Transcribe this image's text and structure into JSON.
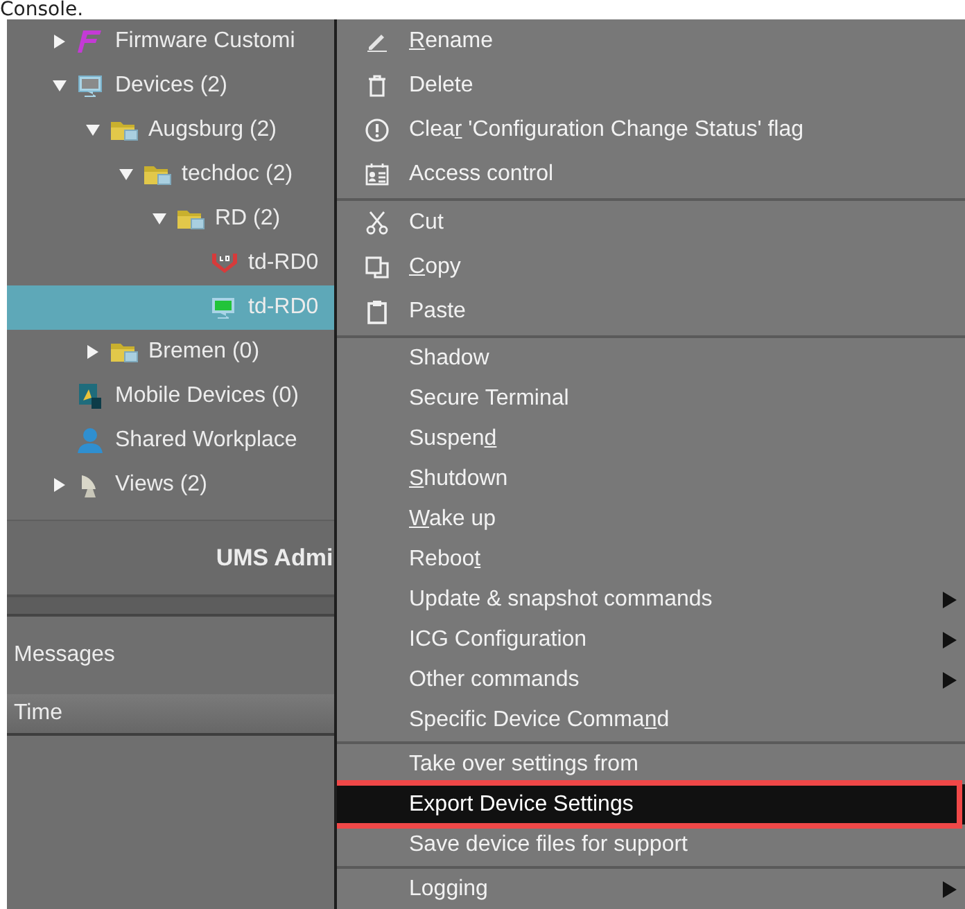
{
  "caption": "Console.",
  "tree": {
    "items": [
      {
        "label": "Firmware Customi",
        "kind": "firmware",
        "expanded": false,
        "selected": false
      },
      {
        "label": "Devices (2)",
        "kind": "devices",
        "expanded": true,
        "selected": false,
        "children": [
          {
            "label": "Augsburg (2)",
            "kind": "folder",
            "expanded": true,
            "selected": false,
            "children": [
              {
                "label": "techdoc (2)",
                "kind": "folder",
                "expanded": true,
                "selected": false,
                "children": [
                  {
                    "label": "RD (2)",
                    "kind": "folder",
                    "expanded": true,
                    "selected": false,
                    "children": [
                      {
                        "label": "td-RD0",
                        "kind": "shield",
                        "selected": false
                      },
                      {
                        "label": "td-RD0",
                        "kind": "device",
                        "selected": true
                      }
                    ]
                  }
                ]
              }
            ]
          },
          {
            "label": "Bremen (0)",
            "kind": "folder",
            "expanded": false,
            "selected": false
          }
        ]
      },
      {
        "label": "Mobile Devices (0)",
        "kind": "mobile",
        "selected": false
      },
      {
        "label": "Shared Workplace",
        "kind": "user",
        "selected": false
      },
      {
        "label": "Views (2)",
        "kind": "views",
        "expanded": false,
        "selected": false
      }
    ]
  },
  "panel": {
    "title": "UMS Admi",
    "messages_label": "Messages",
    "columns": [
      "Time"
    ]
  },
  "menu": {
    "sections": [
      {
        "items": [
          {
            "label_parts": {
              "key": "R",
              "after": "ename"
            },
            "submenu": false,
            "selected": false,
            "outlined": false
          },
          {
            "label": "Delete",
            "submenu": false,
            "selected": false,
            "outlined": false
          },
          {
            "label_parts": {
              "before": "Clea",
              "key": "r",
              "after": " 'Configuration Change Status' flag"
            },
            "submenu": false,
            "selected": false,
            "outlined": false
          },
          {
            "label": "Access control",
            "submenu": false,
            "selected": false,
            "outlined": false
          }
        ]
      },
      {
        "items": [
          {
            "label": "Cut",
            "submenu": false,
            "selected": false,
            "outlined": false
          },
          {
            "label_parts": {
              "key": "C",
              "after": "opy"
            },
            "submenu": false,
            "selected": false,
            "outlined": false
          },
          {
            "label": "Paste",
            "submenu": false,
            "selected": false,
            "outlined": false
          }
        ]
      },
      {
        "items": [
          {
            "label": "Shadow",
            "submenu": false,
            "selected": false,
            "outlined": false
          },
          {
            "label": "Secure Terminal",
            "submenu": false,
            "selected": false,
            "outlined": false
          },
          {
            "label_parts": {
              "before": "Suspen",
              "key": "d"
            },
            "submenu": false,
            "selected": false,
            "outlined": false
          },
          {
            "label_parts": {
              "key": "S",
              "after": "hutdown"
            },
            "submenu": false,
            "selected": false,
            "outlined": false
          },
          {
            "label_parts": {
              "key": "W",
              "after": "ake up"
            },
            "submenu": false,
            "selected": false,
            "outlined": false
          },
          {
            "label_parts": {
              "before": "Reboo",
              "key": "t"
            },
            "submenu": false,
            "selected": false,
            "outlined": false
          },
          {
            "label": "Update & snapshot commands",
            "submenu": true,
            "selected": false,
            "outlined": false
          },
          {
            "label": "ICG Configuration",
            "submenu": true,
            "selected": false,
            "outlined": false
          },
          {
            "label": "Other commands",
            "submenu": true,
            "selected": false,
            "outlined": false
          },
          {
            "label_parts": {
              "before": "Specific Device Comma",
              "key": "n",
              "after": "d"
            },
            "submenu": false,
            "selected": false,
            "outlined": false
          }
        ]
      },
      {
        "items": [
          {
            "label": "Take over settings from",
            "submenu": false,
            "selected": false,
            "outlined": false
          },
          {
            "label": "Export Device Settings",
            "submenu": false,
            "selected": true,
            "outlined": true
          },
          {
            "label": "Save device files for support",
            "submenu": false,
            "selected": false,
            "outlined": false
          }
        ]
      },
      {
        "items": [
          {
            "label": "Logging",
            "submenu": true,
            "selected": false,
            "outlined": false
          }
        ]
      }
    ]
  }
}
